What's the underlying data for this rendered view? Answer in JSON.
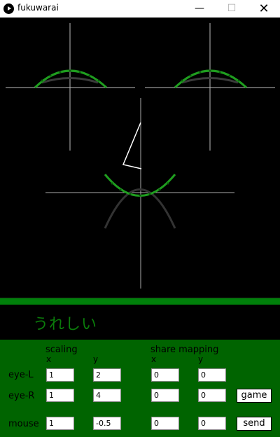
{
  "window": {
    "title": "fukuwarai",
    "min": "—",
    "max": "☐",
    "close": "✕"
  },
  "emotion": "うれしい",
  "headers": {
    "scaling": "scaling",
    "share_mapping": "share mapping",
    "x": "x",
    "y": "y"
  },
  "rows": [
    {
      "label": "eye-L",
      "scaling_x": "1",
      "scaling_y": "2",
      "share_x": "0",
      "share_y": "0",
      "button": ""
    },
    {
      "label": "eye-R",
      "scaling_x": "1",
      "scaling_y": "4",
      "share_x": "0",
      "share_y": "0",
      "button": "game"
    },
    {
      "label": "mouse",
      "scaling_x": "1",
      "scaling_y": "-0.5",
      "share_x": "0",
      "share_y": "0",
      "button": "send"
    }
  ],
  "colors": {
    "panel": "#006400",
    "accent_green": "#00c000",
    "emotion_text": "#0b7b0b"
  }
}
